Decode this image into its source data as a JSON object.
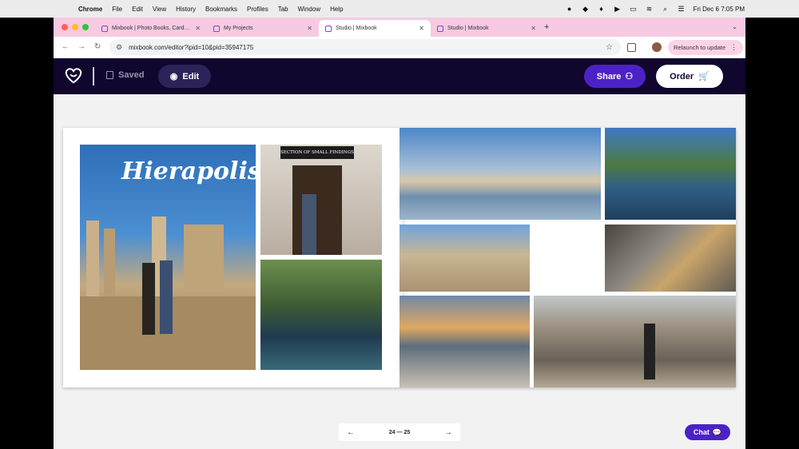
{
  "menubar": {
    "app": "Chrome",
    "items": [
      "File",
      "Edit",
      "View",
      "History",
      "Bookmarks",
      "Profiles",
      "Tab",
      "Window",
      "Help"
    ],
    "clock": "Fri Dec 6  7:05 PM"
  },
  "browser": {
    "tabs": [
      {
        "title": "Mixbook | Photo Books, Card…",
        "active": false
      },
      {
        "title": "My Projects",
        "active": false
      },
      {
        "title": "Studio | Mixbook",
        "active": true
      },
      {
        "title": "Studio | Mixbook",
        "active": false
      }
    ],
    "url": "mixbook.com/editor?ipid=10&pid=35947175",
    "relaunch_label": "Relaunch to update"
  },
  "app": {
    "saved_label": "Saved",
    "edit_label": "Edit",
    "share_label": "Share",
    "order_label": "Order",
    "chat_label": "Chat",
    "page_indicator": "24 — 25",
    "photo_title": "Hierapolis",
    "sign_text": "SECTION OF SMALL FINDINGS"
  },
  "colors": {
    "appbar": "#10062e",
    "accent": "#4c22c7",
    "tabstrip": "#f7c9e2"
  }
}
